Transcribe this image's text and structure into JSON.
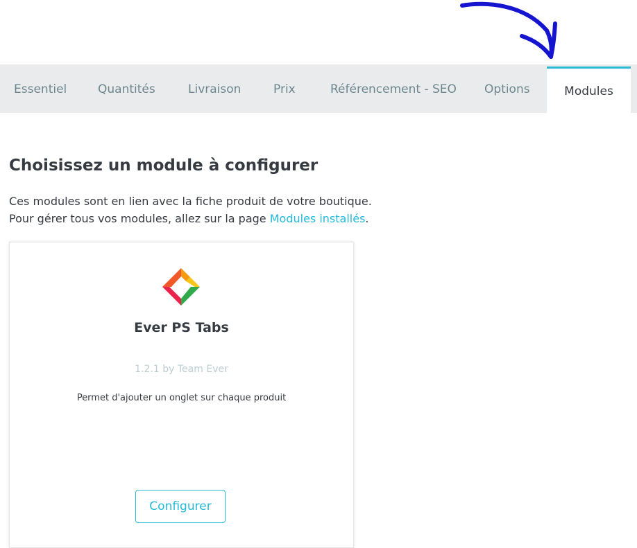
{
  "tabs": [
    {
      "label": "Essentiel",
      "active": false
    },
    {
      "label": "Quantités",
      "active": false
    },
    {
      "label": "Livraison",
      "active": false
    },
    {
      "label": "Prix",
      "active": false
    },
    {
      "label": "Référencement - SEO",
      "active": false
    },
    {
      "label": "Options",
      "active": false
    },
    {
      "label": "Modules",
      "active": true
    }
  ],
  "main": {
    "title": "Choisissez un module à configurer",
    "intro_line1": "Ces modules sont en lien avec la fiche produit de votre boutique.",
    "intro_line2_prefix": "Pour gérer tous vos modules, allez sur la page ",
    "intro_link": "Modules installés",
    "intro_line2_suffix": "."
  },
  "module": {
    "name": "Ever PS Tabs",
    "version": "1.2.1 by Team Ever",
    "description": "Permet d'ajouter un onglet sur chaque produit",
    "configure_label": "Configurer",
    "logo_icon": "diamond-logo-icon"
  },
  "colors": {
    "accent": "#25b9d7",
    "tab_bar": "#eaebec",
    "annotation": "#1515d0",
    "logo": [
      "#f39c12",
      "#f5c518",
      "#2eaa4a",
      "#e8244c"
    ]
  }
}
